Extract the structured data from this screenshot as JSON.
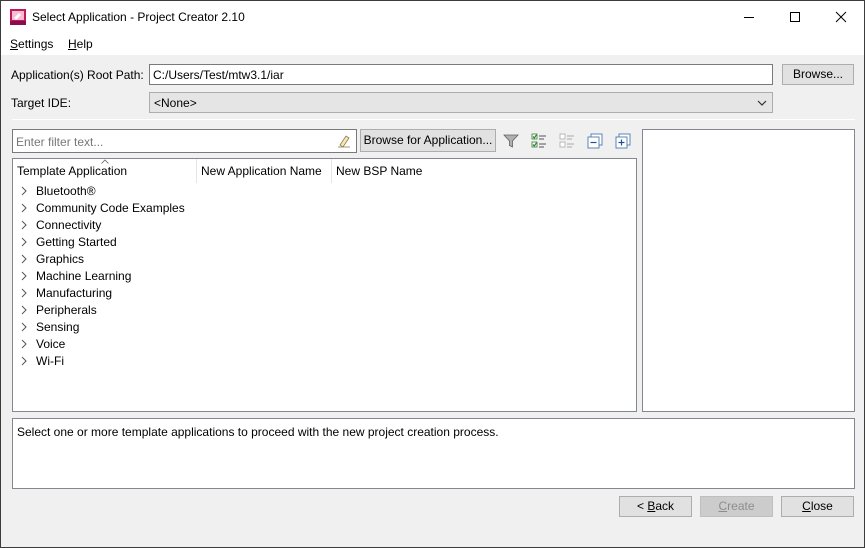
{
  "window": {
    "title": "Select Application - Project Creator 2.10",
    "icon": "project-creator-app-icon"
  },
  "menu": {
    "settings_label": "ettings",
    "settings_accel": "S",
    "help_label": "elp",
    "help_accel": "H"
  },
  "root_path": {
    "label": "Application(s) Root Path:",
    "value": "C:/Users/Test/mtw3.1/iar",
    "browse_label": "Browse..."
  },
  "target_ide": {
    "label": "Target IDE:",
    "value": "<None>"
  },
  "filter": {
    "placeholder": "Enter filter text...",
    "browse_apps_label": "Browse for Application..."
  },
  "toolbar_icons": [
    "funnel-icon",
    "check-all-icon",
    "uncheck-all-icon",
    "collapse-all-icon",
    "expand-all-icon"
  ],
  "table": {
    "headers": [
      "Template Application",
      "New Application Name",
      "New BSP Name"
    ],
    "items": [
      "Bluetooth®",
      "Community Code Examples",
      "Connectivity",
      "Getting Started",
      "Graphics",
      "Machine Learning",
      "Manufacturing",
      "Peripherals",
      "Sensing",
      "Voice",
      "Wi-Fi"
    ]
  },
  "status": {
    "message": "Select one or more template applications to proceed with the new project creation process."
  },
  "footer": {
    "back_prefix": "< ",
    "back_accel": "B",
    "back_rest": "ack",
    "create_accel": "C",
    "create_rest": "reate",
    "close_accel": "C",
    "close_rest": "lose"
  },
  "colors": {
    "titlebar_bg": "#ffffff",
    "window_bg": "#f0f0f0",
    "panel_border": "#828790",
    "disabled_text": "#8d8d8d"
  }
}
